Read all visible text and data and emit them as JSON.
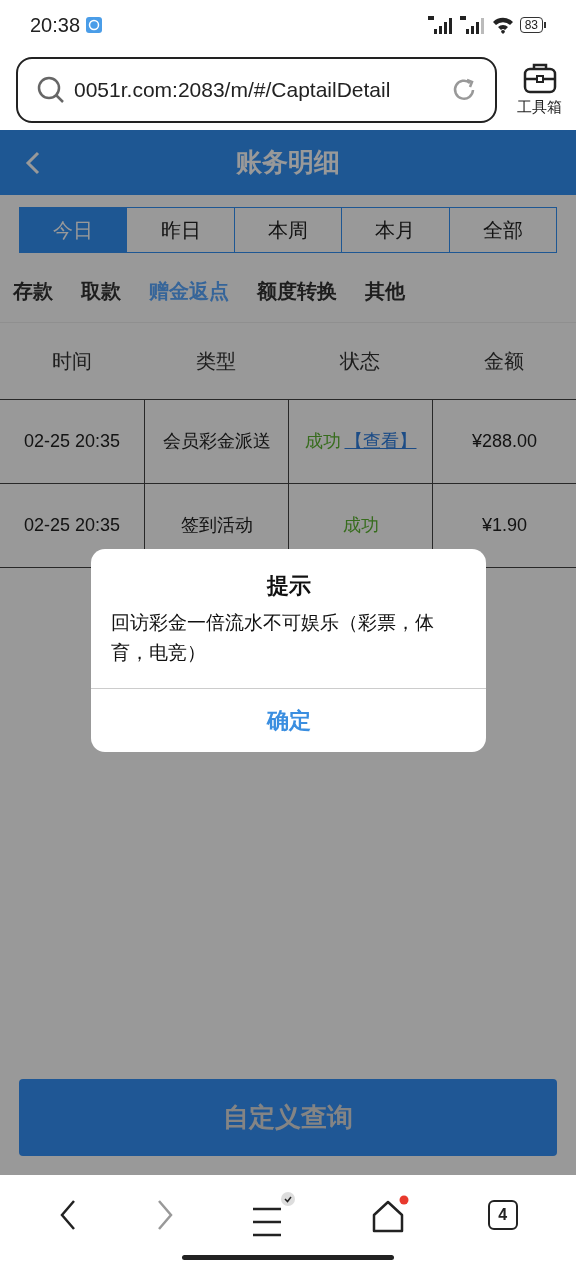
{
  "status_bar": {
    "time": "20:38",
    "battery": "83"
  },
  "browser": {
    "url": "0051r.com:2083/m/#/CaptailDetail",
    "toolbox_label": "工具箱"
  },
  "header": {
    "title": "账务明细"
  },
  "date_tabs": [
    {
      "label": "今日",
      "selected": true
    },
    {
      "label": "昨日",
      "selected": false
    },
    {
      "label": "本周",
      "selected": false
    },
    {
      "label": "本月",
      "selected": false
    },
    {
      "label": "全部",
      "selected": false
    }
  ],
  "categories": [
    {
      "label": "存款",
      "selected": false
    },
    {
      "label": "取款",
      "selected": false
    },
    {
      "label": "赠金返点",
      "selected": true
    },
    {
      "label": "额度转换",
      "selected": false
    },
    {
      "label": "其他",
      "selected": false
    }
  ],
  "table": {
    "columns": [
      "时间",
      "类型",
      "状态",
      "金额"
    ],
    "rows": [
      {
        "time": "02-25 20:35",
        "type": "会员彩金派送",
        "status": "成功",
        "link": "【查看】",
        "amount": "¥288.00"
      },
      {
        "time": "02-25 20:35",
        "type": "签到活动",
        "status": "成功",
        "amount": "¥1.90"
      }
    ]
  },
  "dialog": {
    "title": "提示",
    "message": "回访彩金一倍流水不可娱乐（彩票，体育，电竞）",
    "button": "确定"
  },
  "query_button": "自定义查询",
  "bottom_nav": {
    "tab_count": "4"
  }
}
